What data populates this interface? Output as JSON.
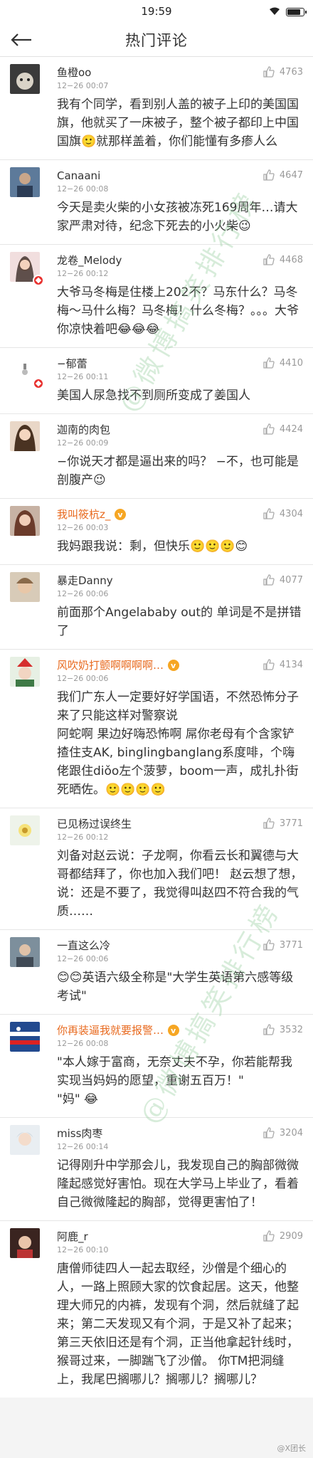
{
  "status": {
    "time": "19:59"
  },
  "nav": {
    "title": "热门评论"
  },
  "watermark": "@微博搞笑排行榜",
  "credit": "@X团长",
  "comments": [
    {
      "name": "鱼橙oo",
      "time": "12−26 00:07",
      "likes": "4763",
      "text": "我有个同学，看到别人盖的被子上印的美国国旗，他就买了一床被子，整个被子都印上中国国旗🙂就那样盖着，你们能懂有多瘆人么"
    },
    {
      "name": "Canaani",
      "time": "12−26 00:08",
      "likes": "4647",
      "text": "今天是卖火柴的小女孩被冻死169周年…请大家严肃对待，纪念下死去的小火柴😉"
    },
    {
      "name": "龙卷_Melody",
      "time": "12−26 00:12",
      "likes": "4468",
      "text": "大爷马冬梅是住楼上202不？马东什么？马冬梅～马什么梅？马冬梅！什么冬梅？。。。大爷你凉快着吧😂😂😂"
    },
    {
      "name": "−郁蕾",
      "time": "12−26 00:11",
      "likes": "4410",
      "text": "美国人尿急找不到厕所变成了姜国人"
    },
    {
      "name": "迦南的肉包",
      "time": "12−26 00:09",
      "likes": "4424",
      "text": "−你说天才都是逼出来的吗？ −不，也可能是剖腹产😉"
    },
    {
      "name": "我叫筱杭z_",
      "time": "12−26 00:03",
      "likes": "4304",
      "text": "我妈跟我说：剩，但快乐🙂🙂🙂😊"
    },
    {
      "name": "暴走Danny",
      "time": "12−26 00:06",
      "likes": "4077",
      "text": "前面那个Angelababy out的 单词是不是拼错了"
    },
    {
      "name": "风吹奶打颤啊啊啊啊…",
      "time": "12−26 00:06",
      "likes": "4134",
      "text": "我们广东人一定要好好学国语，不然恐怖分子来了只能这样对警察说\n阿蛇啊 果边好嗨恐怖啊 屌你老母有个含家铲揸住支AK, binglingbanglang系度啡，个嗨佬跟住diǒo左个菠萝，boom一声，成扎扑街死晒佐。🙂🙂🙂🙂"
    },
    {
      "name": "已见杨过误终生",
      "time": "12−26 00:12",
      "likes": "3771",
      "text": "刘备对赵云说：子龙啊，你看云长和翼德与大哥都结拜了，你也加入我们吧！ 赵云想了想，说：还是不要了，我觉得叫赵四不符合我的气质……"
    },
    {
      "name": "一直这么冷",
      "time": "12−26 00:06",
      "likes": "3771",
      "text": "😊😊英语六级全称是\"大学生英语第六感等级考试\""
    },
    {
      "name": "你再装逼我就要报警…",
      "time": "12−26 00:08",
      "likes": "3532",
      "text": "\"本人嫁于富商，无奈丈夫不孕，你若能帮我实现当妈妈的愿望，重谢五百万！\"\n\"妈\" 😂"
    },
    {
      "name": "miss肉枣",
      "time": "12−26 00:14",
      "likes": "3204",
      "text": "记得刚升中学那会儿，我发现自己的胸部微微隆起感觉好害怕。现在大学马上毕业了，看着自己微微隆起的胸部，觉得更害怕了！"
    },
    {
      "name": "阿鹿_r",
      "time": "12−26 00:10",
      "likes": "2909",
      "text": "唐僧师徒四人一起去取经，沙僧是个细心的人，一路上照顾大家的饮食起居。这天，他整理大师兄的内裤，发现有个洞，然后就缝了起来；第二天发现又有个洞，于是又补了起来；第三天依旧还是有个洞，正当他拿起针线时，猴哥过来，一脚踹飞了沙僧。 你TM把洞缝上，我尾巴搁哪儿？搁哪儿？搁哪儿？"
    }
  ],
  "colors": {
    "vip_name": "#e86a1f",
    "badge": "#e8302e"
  }
}
